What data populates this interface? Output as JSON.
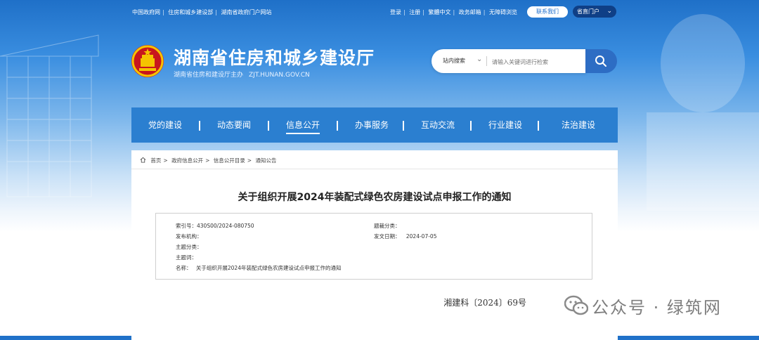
{
  "topbar": {
    "left_links": [
      "中国政府网",
      "住房和城乡建设部",
      "湖南省政府门户网站"
    ],
    "right_links": [
      "登录",
      "注册",
      "繁體中文",
      "政务邮箱",
      "无障碍浏览"
    ],
    "contact_label": "联系我们",
    "portal_label": "省直门户"
  },
  "header": {
    "title": "湖南省住房和城乡建设厅",
    "sponsor": "湖南省住房和建设厅主办",
    "domain": "ZJT.HUNAN.GOV.CN"
  },
  "search": {
    "scope": "站内搜索",
    "placeholder": "请输入关键词进行检索",
    "value": ""
  },
  "nav": {
    "items": [
      "党的建设",
      "动态要闻",
      "信息公开",
      "办事服务",
      "互动交流",
      "行业建设",
      "法治建设"
    ],
    "active_index": 2
  },
  "breadcrumb": [
    "首页",
    "政府信息公开",
    "信息公开目录",
    "通知公告"
  ],
  "article": {
    "title": "关于组织开展2024年装配式绿色农房建设试点申报工作的通知",
    "meta": {
      "index_no": "索引号：430S00/2024-080750",
      "topic_class": "题裁分类：",
      "publisher": "发布机构：",
      "issue_date_label": "发文日期：",
      "issue_date": "2024-07-05",
      "subject_class": "主题分类：",
      "keywords": "主题词：",
      "name": "名称：",
      "name_value": "关于组织开展2024年装配式绿色农房建设试点申报工作的通知"
    },
    "doc_number": "湘建科〔2024〕69号"
  },
  "watermark": {
    "text": "公众号 · 绿筑网",
    "icon": "wechat-icon"
  }
}
